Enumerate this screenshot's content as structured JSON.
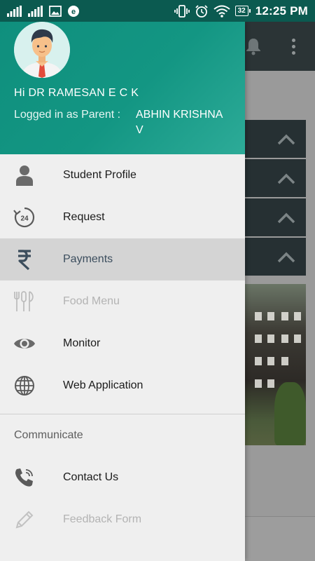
{
  "status_bar": {
    "time": "12:25 PM",
    "battery": "32",
    "icons": [
      "signal-icon",
      "signal-icon",
      "image-icon",
      "browser-icon",
      "vibrate-icon",
      "alarm-icon",
      "wifi-icon",
      "battery-icon"
    ]
  },
  "drawer": {
    "greeting": "Hi DR RAMESAN E C K",
    "logged_in_label": "Logged in as Parent :",
    "logged_in_name": "ABHIN KRISHNA V",
    "accent_color": "#139683",
    "menu": [
      {
        "label": "Student Profile",
        "icon": "person-icon",
        "state": "normal"
      },
      {
        "label": "Request",
        "icon": "clock-24-icon",
        "state": "normal"
      },
      {
        "label": "Payments",
        "icon": "rupee-icon",
        "state": "selected"
      },
      {
        "label": "Food Menu",
        "icon": "cutlery-icon",
        "state": "disabled"
      },
      {
        "label": "Monitor",
        "icon": "eye-icon",
        "state": "normal"
      },
      {
        "label": "Web Application",
        "icon": "globe-icon",
        "state": "normal"
      }
    ],
    "section": "Communicate",
    "communicate_menu": [
      {
        "label": "Contact Us",
        "icon": "phone-icon",
        "state": "normal"
      },
      {
        "label": "Feedback Form",
        "icon": "pencil-icon",
        "state": "disabled"
      }
    ]
  },
  "background": {
    "toolbar_icons": [
      "bell-icon",
      "more-icon"
    ],
    "rows": [
      "chevron-up-icon",
      "chevron-up-icon",
      "chevron-up-icon",
      "chevron-up-icon"
    ]
  }
}
